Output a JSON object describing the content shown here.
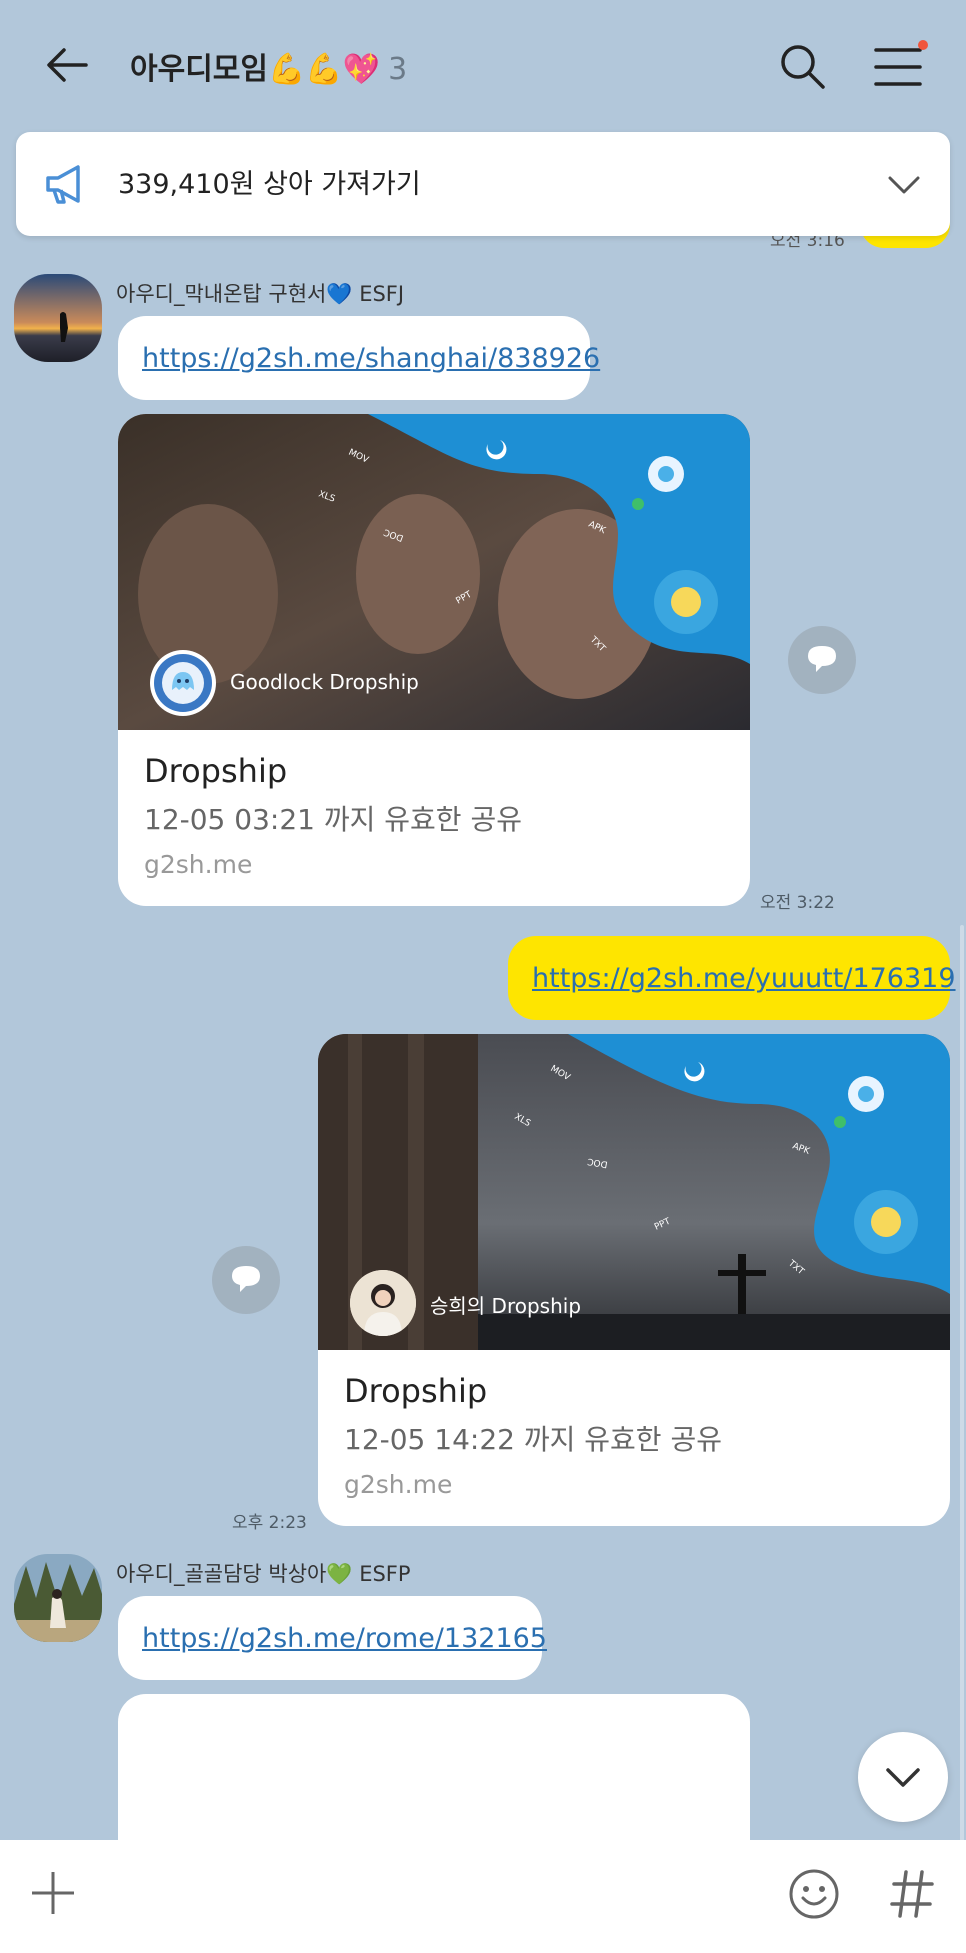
{
  "header": {
    "title": "아우디모임💪💪💖",
    "member_count": "3"
  },
  "notice": {
    "text": "339,410원 상아 가져가기"
  },
  "clipped": {
    "time": "오전 3:16"
  },
  "messages": [
    {
      "sender": "아우디_막내온탑 구현서💙 ESFJ",
      "link": "https://g2sh.me/shanghai/838926",
      "card": {
        "brand": "Goodlock Dropship",
        "title": "Dropship",
        "subtitle": "12-05 03:21 까지 유효한 공유",
        "domain": "g2sh.me"
      },
      "time": "오전 3:22"
    },
    {
      "link": "https://g2sh.me/yuuutt/176319",
      "card": {
        "brand": "승희의 Dropship",
        "title": "Dropship",
        "subtitle": "12-05 14:22 까지 유효한 공유",
        "domain": "g2sh.me"
      },
      "time": "오후 2:23"
    },
    {
      "sender": "아우디_골골담당 박상아💚 ESFP",
      "link": "https://g2sh.me/rome/132165"
    }
  ],
  "image_labels": [
    "MOV",
    "XLS",
    "DOC",
    "APK",
    "PPT",
    "TXT"
  ],
  "colors": {
    "background": "#b2c7da",
    "my_bubble": "#fee500",
    "link": "#2a6fb0"
  },
  "icons": [
    "back-arrow-icon",
    "search-icon",
    "menu-icon",
    "megaphone-icon",
    "chevron-down-icon",
    "share-icon",
    "plus-icon",
    "emoji-icon",
    "hash-icon"
  ]
}
